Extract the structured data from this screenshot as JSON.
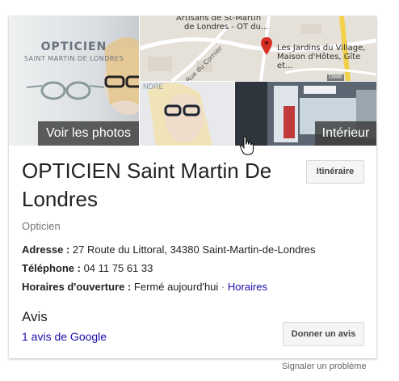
{
  "photos": {
    "sign_line1": "OPTICIEN",
    "sign_line2": "SAINT MARTIN DE LONDRES",
    "view_photos_label": "Voir les photos",
    "interior_label": "Intérieur",
    "map": {
      "top_label_1": "Artisans de St-Martin",
      "top_label_2": "de Londres - OT du...",
      "poi_line1": "Les Jardins du Village,",
      "poi_line2": "Maison d'Hôtes, Gîte et...",
      "road_label": "Rue du Cornier",
      "road_number": "D986",
      "pin_color": "#d93025"
    }
  },
  "business": {
    "name": "OPTICIEN Saint Martin De Londres",
    "directions_button": "Itinéraire",
    "category": "Opticien",
    "address_label": "Adresse :",
    "address_value": "27 Route du Littoral, 34380 Saint-Martin-de-Londres",
    "phone_label": "Téléphone :",
    "phone_value": "04 11 75 61 33",
    "hours_label": "Horaires d'ouverture :",
    "hours_value": "Fermé aujourd'hui",
    "hours_separator": "·",
    "hours_link": "Horaires"
  },
  "reviews": {
    "heading": "Avis",
    "count_link": "1 avis de Google",
    "write_button": "Donner un avis"
  },
  "footer": {
    "report_link": "Signaler un problème"
  },
  "colors": {
    "link": "#1a0dab",
    "overlay": "#3c3c3c",
    "button_bg": "#f5f5f5"
  }
}
